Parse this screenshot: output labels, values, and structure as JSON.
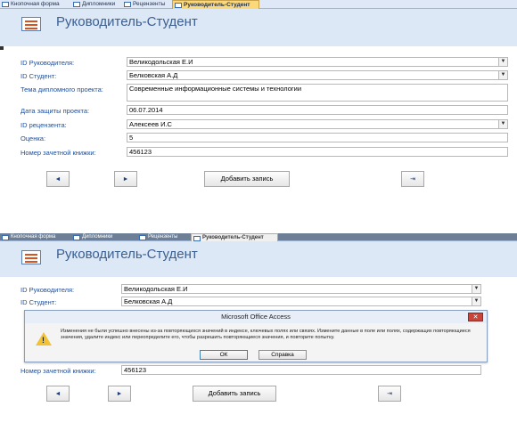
{
  "tabs": [
    {
      "label": "Кнопочная форма",
      "active": false
    },
    {
      "label": "Дипломники",
      "active": false
    },
    {
      "label": "Рецензенты",
      "active": false
    },
    {
      "label": "Руководитель-Студент",
      "active": true
    }
  ],
  "form": {
    "title": "Руководитель-Студент",
    "fields": {
      "supervisor": {
        "label": "ID Руководителя:",
        "value": "Великодольская Е.И"
      },
      "student": {
        "label": "ID Студент:",
        "value": "Белковская А.Д"
      },
      "topic": {
        "label": "Тема дипломного проекта:",
        "value": "Современные информационные системы и технологии"
      },
      "defense_date": {
        "label": "Дата защиты проекта:",
        "value": "06.07.2014"
      },
      "reviewer": {
        "label": "ID рецензента:",
        "value": "Алексеев И.С"
      },
      "grade": {
        "label": "Оценка:",
        "value": "5"
      },
      "record_book": {
        "label": "Номер зачетной книжки:",
        "value": "456123"
      }
    },
    "buttons": {
      "prev": "◄",
      "next": "►",
      "add": "Добавить запись",
      "exit": "⇥"
    }
  },
  "dialog": {
    "title": "Microsoft Office Access",
    "close": "✕",
    "message": "Изменения не были успешно внесены из-за повторяющихся значений в индексе, ключевых полях или связях.  Измените данные в поле или полях, содержащих повторяющиеся значения, удалите индекс или переопределите его, чтобы разрешить повторяющиеся значения, и повторите попытку.",
    "ok": "ОК",
    "help": "Справка"
  },
  "colors": {
    "accent": "#3a5f91",
    "label": "#1f4e99",
    "tab_active": "#fbd87a",
    "header_bg": "#dde8f6",
    "warning": "#f1c232"
  }
}
